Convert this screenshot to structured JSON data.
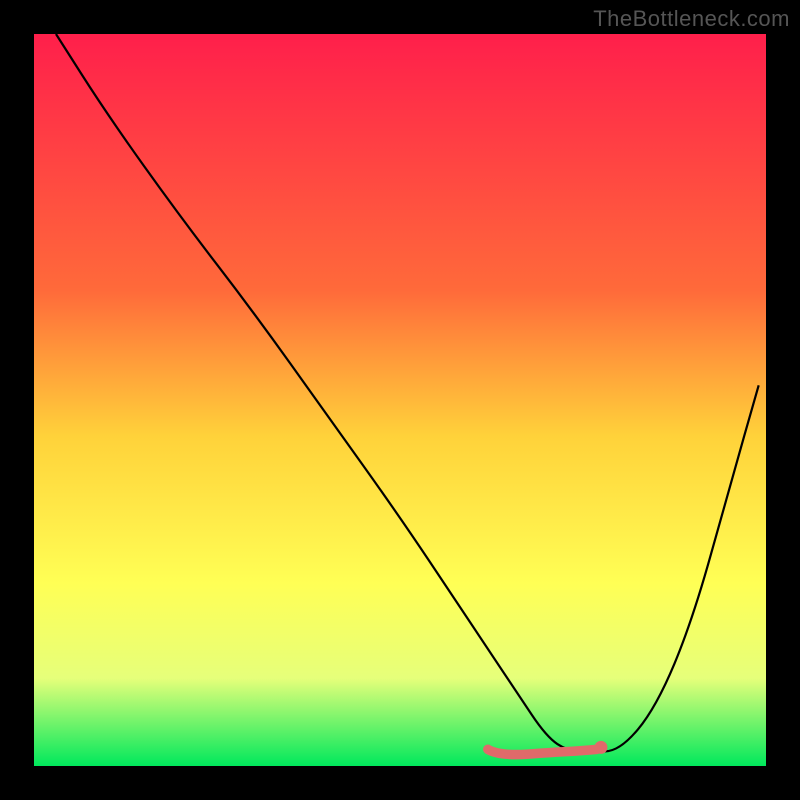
{
  "watermark": "TheBottleneck.com",
  "chart_data": {
    "type": "line",
    "title": "",
    "xlabel": "",
    "ylabel": "",
    "xlim": [
      0,
      100
    ],
    "ylim": [
      0,
      100
    ],
    "grid": false,
    "legend": false,
    "background_gradient_stops": [
      {
        "offset": 0,
        "color": "#ff1f4b"
      },
      {
        "offset": 35,
        "color": "#ff6a3a"
      },
      {
        "offset": 55,
        "color": "#ffd23a"
      },
      {
        "offset": 75,
        "color": "#ffff55"
      },
      {
        "offset": 88,
        "color": "#e6ff7a"
      },
      {
        "offset": 100,
        "color": "#00e85c"
      }
    ],
    "series": [
      {
        "name": "bottleneck-curve",
        "color": "#000000",
        "x": [
          3,
          10,
          20,
          30,
          40,
          50,
          58,
          62,
          66,
          70,
          73,
          76,
          80,
          85,
          90,
          95,
          99
        ],
        "values": [
          100,
          89,
          75,
          62,
          48,
          34,
          22,
          16,
          10,
          4,
          2,
          2,
          2,
          8,
          20,
          38,
          52
        ]
      }
    ],
    "flat_zone": {
      "xStart": 62,
      "xEnd": 78,
      "yApprox": 2,
      "color": "#e06a6a",
      "thickness": 3,
      "end_dot_radius": 5
    }
  }
}
